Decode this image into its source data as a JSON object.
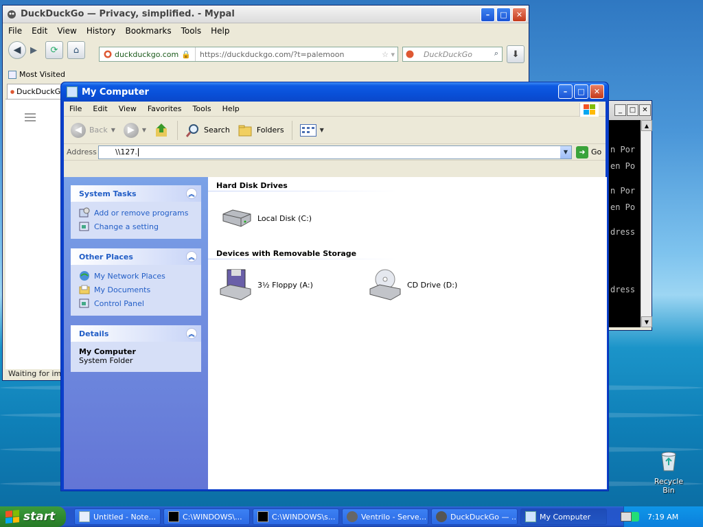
{
  "browser": {
    "title": "DuckDuckGo — Privacy, simplified. - Mypal",
    "menu": [
      "File",
      "Edit",
      "View",
      "History",
      "Bookmarks",
      "Tools",
      "Help"
    ],
    "url_site": "duckduckgo.com",
    "url": "https://duckduckgo.com/?t=palemoon",
    "search_placeholder": "DuckDuckGo",
    "bookmark": "Most Visited",
    "tab_label": "DuckDuckGo",
    "status": "Waiting for impr"
  },
  "console": {
    "lines": [
      "n Por",
      "en Po",
      "n Por",
      "en Po",
      "dress",
      "dress"
    ]
  },
  "my_computer": {
    "title": "My Computer",
    "menu": [
      "File",
      "Edit",
      "View",
      "Favorites",
      "Tools",
      "Help"
    ],
    "toolbar": {
      "back": "Back",
      "search": "Search",
      "folders": "Folders"
    },
    "address_label": "Address",
    "address_value": "\\\\127.",
    "go_label": "Go",
    "system_tasks": {
      "title": "System Tasks",
      "items": [
        "Add or remove programs",
        "Change a setting"
      ]
    },
    "other_places": {
      "title": "Other Places",
      "items": [
        "My Network Places",
        "My Documents",
        "Control Panel"
      ]
    },
    "details": {
      "title": "Details",
      "name": "My Computer",
      "type": "System Folder"
    },
    "groups": [
      {
        "title": "Hard Disk Drives",
        "items": [
          "Local Disk (C:)"
        ]
      },
      {
        "title": "Devices with Removable Storage",
        "items": [
          "3½ Floppy (A:)",
          "CD Drive (D:)"
        ]
      }
    ]
  },
  "desktop": {
    "recycle_bin": "Recycle Bin"
  },
  "taskbar": {
    "start": "start",
    "tasks": [
      "Untitled - Note...",
      "C:\\WINDOWS\\...",
      "C:\\WINDOWS\\s...",
      "Ventrilo - Serve...",
      "DuckDuckGo — ...",
      "My Computer"
    ],
    "clock": "7:19 AM"
  }
}
